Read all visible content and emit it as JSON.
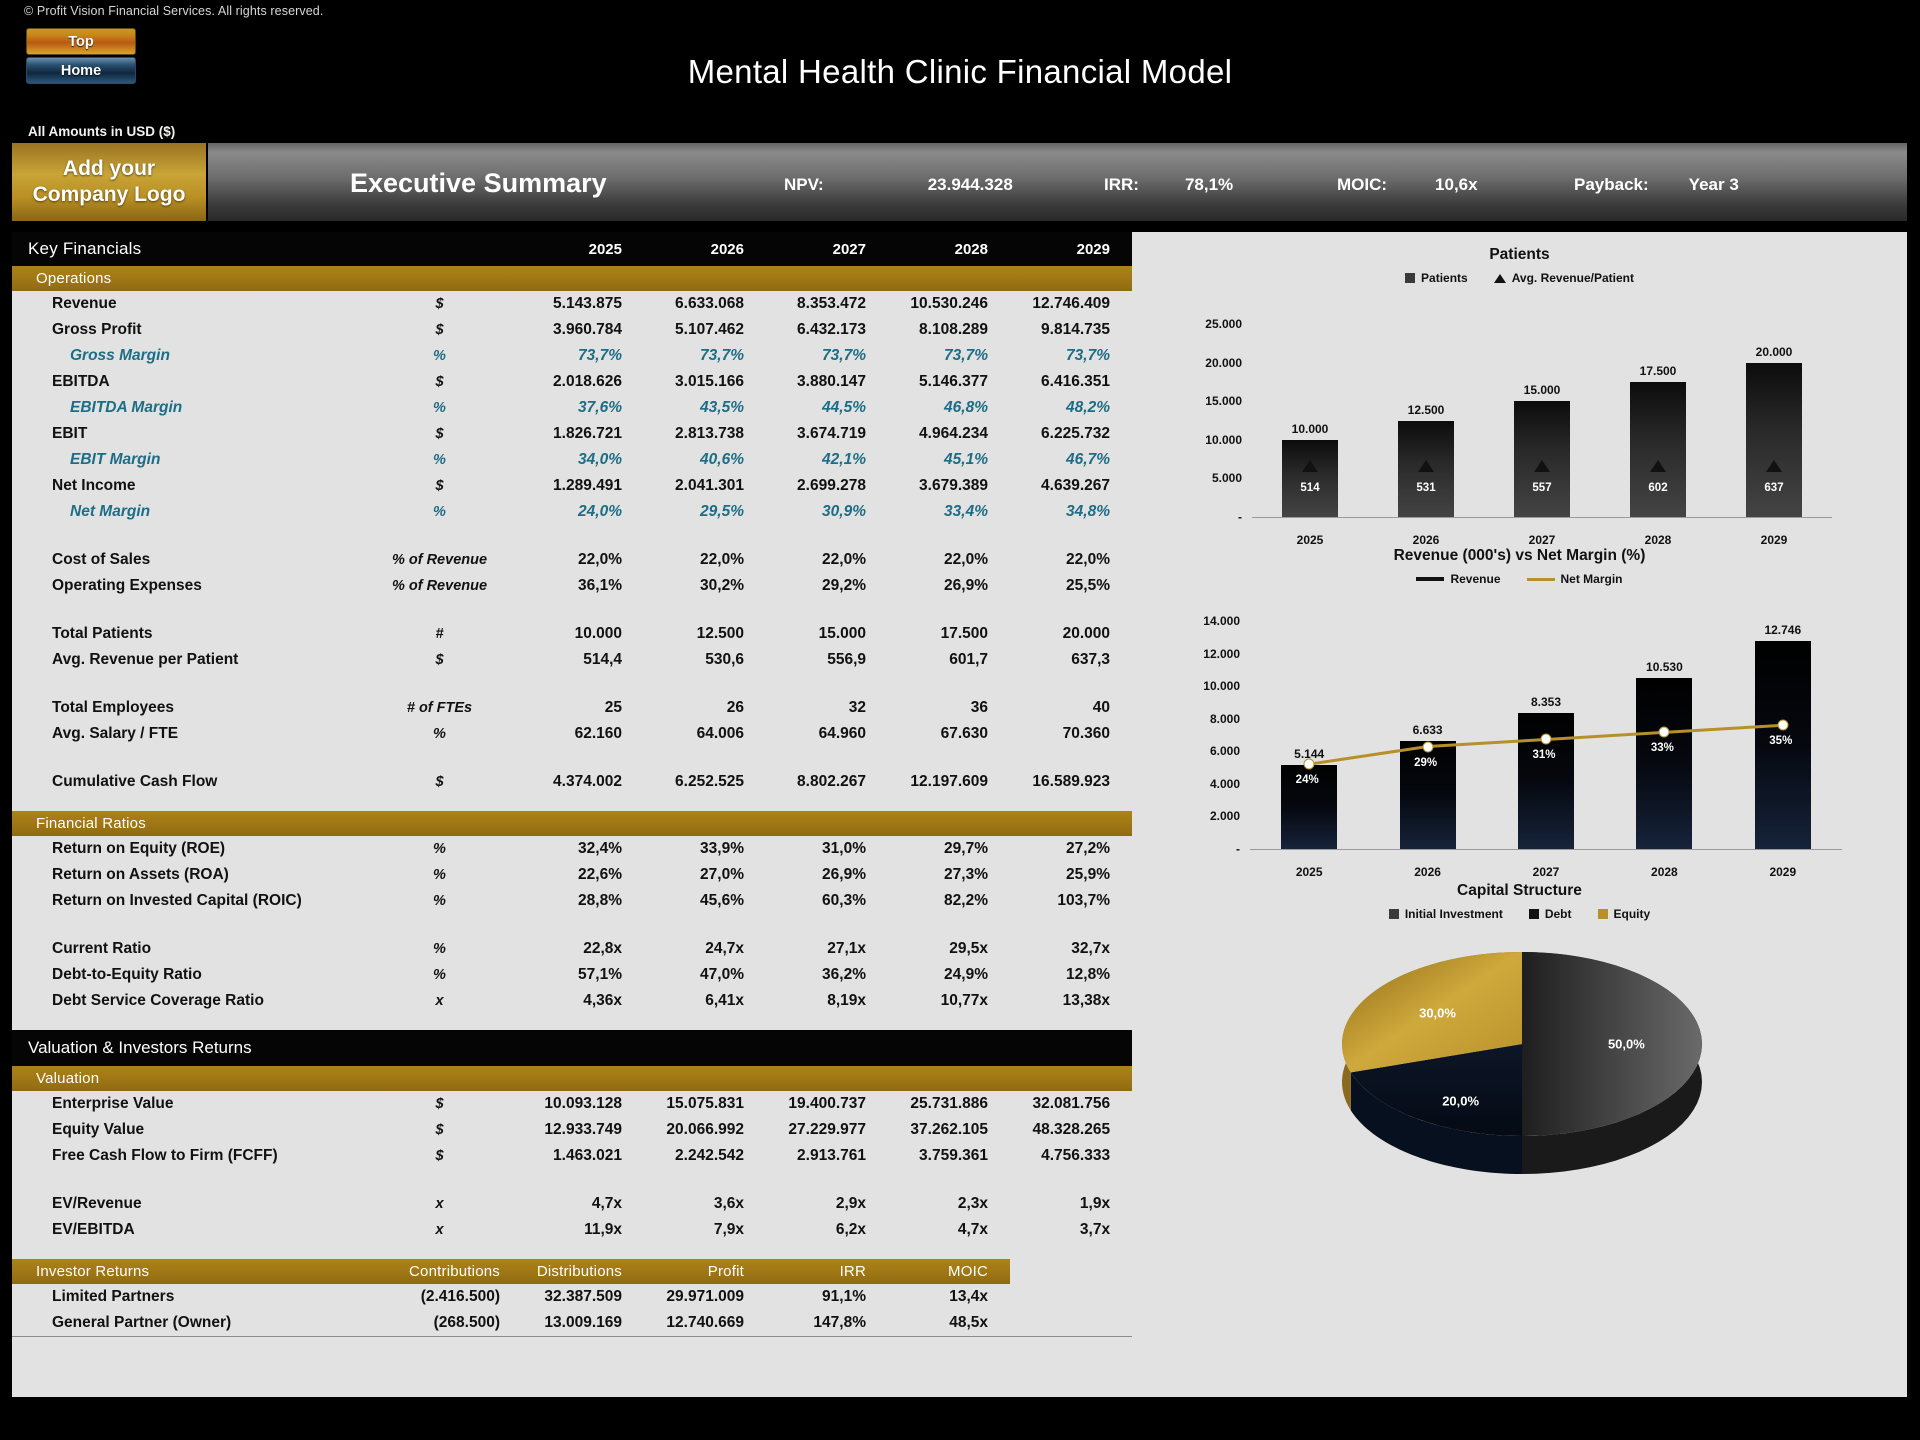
{
  "copyright": "© Profit Vision Financial Services. All rights reserved.",
  "nav": {
    "top": "Top",
    "home": "Home"
  },
  "document_title": "Mental Health Clinic Financial Model",
  "amounts_note": "All Amounts in  USD ($)",
  "banner": {
    "logo_line1": "Add your",
    "logo_line2": "Company Logo",
    "title": "Executive Summary",
    "kpis": [
      {
        "label": "NPV:",
        "value": "23.944.328"
      },
      {
        "label": "IRR:",
        "value": "78,1%"
      },
      {
        "label": "MOIC:",
        "value": "10,6x"
      },
      {
        "label": "Payback:",
        "value": "Year 3"
      }
    ]
  },
  "key_financials": {
    "header": "Key Financials",
    "years": [
      "2025",
      "2026",
      "2027",
      "2028",
      "2029"
    ],
    "operations_header": "Operations",
    "operations_rows": [
      {
        "label": "Revenue",
        "unit": "$",
        "values": [
          "5.143.875",
          "6.633.068",
          "8.353.472",
          "10.530.246",
          "12.746.409"
        ],
        "sub": false
      },
      {
        "label": "Gross Profit",
        "unit": "$",
        "values": [
          "3.960.784",
          "5.107.462",
          "6.432.173",
          "8.108.289",
          "9.814.735"
        ],
        "sub": false
      },
      {
        "label": "Gross Margin",
        "unit": "%",
        "values": [
          "73,7%",
          "73,7%",
          "73,7%",
          "73,7%",
          "73,7%"
        ],
        "sub": true
      },
      {
        "label": "EBITDA",
        "unit": "$",
        "values": [
          "2.018.626",
          "3.015.166",
          "3.880.147",
          "5.146.377",
          "6.416.351"
        ],
        "sub": false
      },
      {
        "label": "EBITDA Margin",
        "unit": "%",
        "values": [
          "37,6%",
          "43,5%",
          "44,5%",
          "46,8%",
          "48,2%"
        ],
        "sub": true
      },
      {
        "label": "EBIT",
        "unit": "$",
        "values": [
          "1.826.721",
          "2.813.738",
          "3.674.719",
          "4.964.234",
          "6.225.732"
        ],
        "sub": false
      },
      {
        "label": "EBIT Margin",
        "unit": "%",
        "values": [
          "34,0%",
          "40,6%",
          "42,1%",
          "45,1%",
          "46,7%"
        ],
        "sub": true
      },
      {
        "label": "Net Income",
        "unit": "$",
        "values": [
          "1.289.491",
          "2.041.301",
          "2.699.278",
          "3.679.389",
          "4.639.267"
        ],
        "sub": false
      },
      {
        "label": "Net Margin",
        "unit": "%",
        "values": [
          "24,0%",
          "29,5%",
          "30,9%",
          "33,4%",
          "34,8%"
        ],
        "sub": true
      }
    ],
    "cost_rows": [
      {
        "label": "Cost of Sales",
        "unit": "% of Revenue",
        "values": [
          "22,0%",
          "22,0%",
          "22,0%",
          "22,0%",
          "22,0%"
        ],
        "sub": false
      },
      {
        "label": "Operating Expenses",
        "unit": "% of Revenue",
        "values": [
          "36,1%",
          "30,2%",
          "29,2%",
          "26,9%",
          "25,5%"
        ],
        "sub": false
      }
    ],
    "patient_rows": [
      {
        "label": "Total Patients",
        "unit": "#",
        "values": [
          "10.000",
          "12.500",
          "15.000",
          "17.500",
          "20.000"
        ],
        "sub": false
      },
      {
        "label": "Avg. Revenue per Patient",
        "unit": "$",
        "values": [
          "514,4",
          "530,6",
          "556,9",
          "601,7",
          "637,3"
        ],
        "sub": false
      }
    ],
    "employee_rows": [
      {
        "label": "Total Employees",
        "unit": "# of FTEs",
        "values": [
          "25",
          "26",
          "32",
          "36",
          "40"
        ],
        "sub": false
      },
      {
        "label": "Avg. Salary / FTE",
        "unit": "%",
        "values": [
          "62.160",
          "64.006",
          "64.960",
          "67.630",
          "70.360"
        ],
        "sub": false
      }
    ],
    "cash_rows": [
      {
        "label": "Cumulative Cash Flow",
        "unit": "$",
        "values": [
          "4.374.002",
          "6.252.525",
          "8.802.267",
          "12.197.609",
          "16.589.923"
        ],
        "sub": false
      }
    ],
    "ratios_header": "Financial Ratios",
    "return_rows": [
      {
        "label": "Return on Equity (ROE)",
        "unit": "%",
        "values": [
          "32,4%",
          "33,9%",
          "31,0%",
          "29,7%",
          "27,2%"
        ],
        "sub": false
      },
      {
        "label": "Return on Assets (ROA)",
        "unit": "%",
        "values": [
          "22,6%",
          "27,0%",
          "26,9%",
          "27,3%",
          "25,9%"
        ],
        "sub": false
      },
      {
        "label": "Return on Invested Capital (ROIC)",
        "unit": "%",
        "values": [
          "28,8%",
          "45,6%",
          "60,3%",
          "82,2%",
          "103,7%"
        ],
        "sub": false
      }
    ],
    "leverage_rows": [
      {
        "label": "Current Ratio",
        "unit": "%",
        "values": [
          "22,8x",
          "24,7x",
          "27,1x",
          "29,5x",
          "32,7x"
        ],
        "sub": false
      },
      {
        "label": "Debt-to-Equity Ratio",
        "unit": "%",
        "values": [
          "57,1%",
          "47,0%",
          "36,2%",
          "24,9%",
          "12,8%"
        ],
        "sub": false
      },
      {
        "label": "Debt Service Coverage Ratio",
        "unit": "x",
        "values": [
          "4,36x",
          "6,41x",
          "8,19x",
          "10,77x",
          "13,38x"
        ],
        "sub": false
      }
    ]
  },
  "valuation": {
    "header": "Valuation & Investors Returns",
    "valuation_header": "Valuation",
    "valuation_rows": [
      {
        "label": "Enterprise Value",
        "unit": "$",
        "values": [
          "10.093.128",
          "15.075.831",
          "19.400.737",
          "25.731.886",
          "32.081.756"
        ],
        "sub": false
      },
      {
        "label": "Equity Value",
        "unit": "$",
        "values": [
          "12.933.749",
          "20.066.992",
          "27.229.977",
          "37.262.105",
          "48.328.265"
        ],
        "sub": false
      },
      {
        "label": "Free Cash Flow to Firm (FCFF)",
        "unit": "$",
        "values": [
          "1.463.021",
          "2.242.542",
          "2.913.761",
          "3.759.361",
          "4.756.333"
        ],
        "sub": false
      }
    ],
    "multiple_rows": [
      {
        "label": "EV/Revenue",
        "unit": "x",
        "values": [
          "4,7x",
          "3,6x",
          "2,9x",
          "2,3x",
          "1,9x"
        ],
        "sub": false
      },
      {
        "label": "EV/EBITDA",
        "unit": "x",
        "values": [
          "11,9x",
          "7,9x",
          "6,2x",
          "4,7x",
          "3,7x"
        ],
        "sub": false
      }
    ],
    "investor_header": "Investor Returns",
    "investor_columns": [
      "Contributions",
      "Distributions",
      "Profit",
      "IRR",
      "MOIC"
    ],
    "investor_rows": [
      {
        "label": "Limited Partners",
        "values": [
          "(2.416.500)",
          "32.387.509",
          "29.971.009",
          "91,1%",
          "13,4x"
        ]
      },
      {
        "label": "General Partner (Owner)",
        "values": [
          "(268.500)",
          "13.009.169",
          "12.740.669",
          "147,8%",
          "48,5x"
        ]
      }
    ]
  },
  "chart_data": [
    {
      "type": "bar",
      "title": "Patients",
      "categories": [
        "2025",
        "2026",
        "2027",
        "2028",
        "2029"
      ],
      "legend": [
        "Patients",
        "Avg. Revenue/Patient"
      ],
      "legend_position": "top",
      "ylim": [
        0,
        25000
      ],
      "yticks": [
        "-",
        "5.000",
        "10.000",
        "15.000",
        "20.000",
        "25.000"
      ],
      "series": [
        {
          "name": "Patients",
          "values": [
            10000,
            12500,
            15000,
            17500,
            20000
          ],
          "labels": [
            "10.000",
            "12.500",
            "15.000",
            "17.500",
            "20.000"
          ]
        },
        {
          "name": "Avg. Revenue/Patient",
          "values": [
            514,
            531,
            557,
            602,
            637
          ],
          "labels": [
            "514",
            "531",
            "557",
            "602",
            "637"
          ]
        }
      ]
    },
    {
      "type": "bar",
      "title": "Revenue (000's) vs Net Margin (%)",
      "categories": [
        "2025",
        "2026",
        "2027",
        "2028",
        "2029"
      ],
      "legend": [
        "Revenue",
        "Net Margin"
      ],
      "legend_position": "top",
      "ylim": [
        0,
        14000
      ],
      "yticks": [
        "-",
        "2.000",
        "4.000",
        "6.000",
        "8.000",
        "10.000",
        "12.000",
        "14.000"
      ],
      "series": [
        {
          "name": "Revenue",
          "values": [
            5144,
            6633,
            8353,
            10530,
            12746
          ],
          "labels": [
            "5.144",
            "6.633",
            "8.353",
            "10.530",
            "12.746"
          ]
        },
        {
          "name": "Net Margin",
          "values": [
            24,
            29,
            31,
            33,
            35
          ],
          "labels": [
            "24%",
            "29%",
            "31%",
            "33%",
            "35%"
          ]
        }
      ]
    },
    {
      "type": "pie",
      "title": "Capital Structure",
      "legend": [
        "Initial Investment",
        "Debt",
        "Equity"
      ],
      "labels": [
        "Initial Investment",
        "Debt",
        "Equity"
      ],
      "values": [
        50.0,
        20.0,
        30.0
      ],
      "value_labels": [
        "50,0%",
        "20,0%",
        "30,0%"
      ],
      "colors": [
        "#2b2b2b",
        "#0d1628",
        "#b8902a"
      ]
    }
  ]
}
